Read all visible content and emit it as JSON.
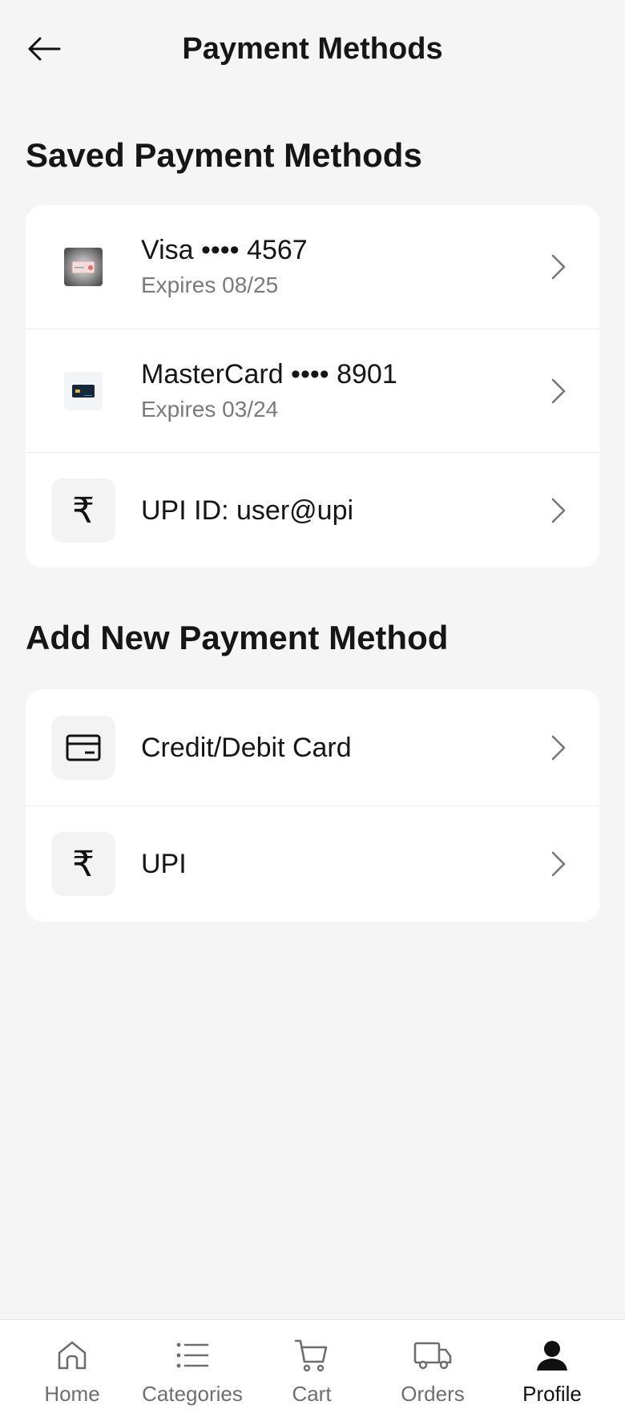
{
  "header": {
    "title": "Payment Methods"
  },
  "saved": {
    "title": "Saved Payment Methods",
    "items": [
      {
        "label": "Visa •••• 4567",
        "sub": "Expires 08/25",
        "icon": "visa-card-thumbnail"
      },
      {
        "label": "MasterCard •••• 8901",
        "sub": "Expires 03/24",
        "icon": "mastercard-thumbnail"
      },
      {
        "label": "UPI ID: user@upi",
        "icon": "rupee-icon"
      }
    ]
  },
  "add_new": {
    "title": "Add New Payment Method",
    "items": [
      {
        "label": "Credit/Debit Card",
        "icon": "credit-card-icon"
      },
      {
        "label": "UPI",
        "icon": "rupee-icon"
      }
    ]
  },
  "rupee_symbol": "₹",
  "nav": {
    "items": [
      {
        "label": "Home",
        "icon": "home-icon"
      },
      {
        "label": "Categories",
        "icon": "list-icon"
      },
      {
        "label": "Cart",
        "icon": "cart-icon"
      },
      {
        "label": "Orders",
        "icon": "truck-icon"
      },
      {
        "label": "Profile",
        "icon": "person-icon",
        "active": true
      }
    ]
  }
}
